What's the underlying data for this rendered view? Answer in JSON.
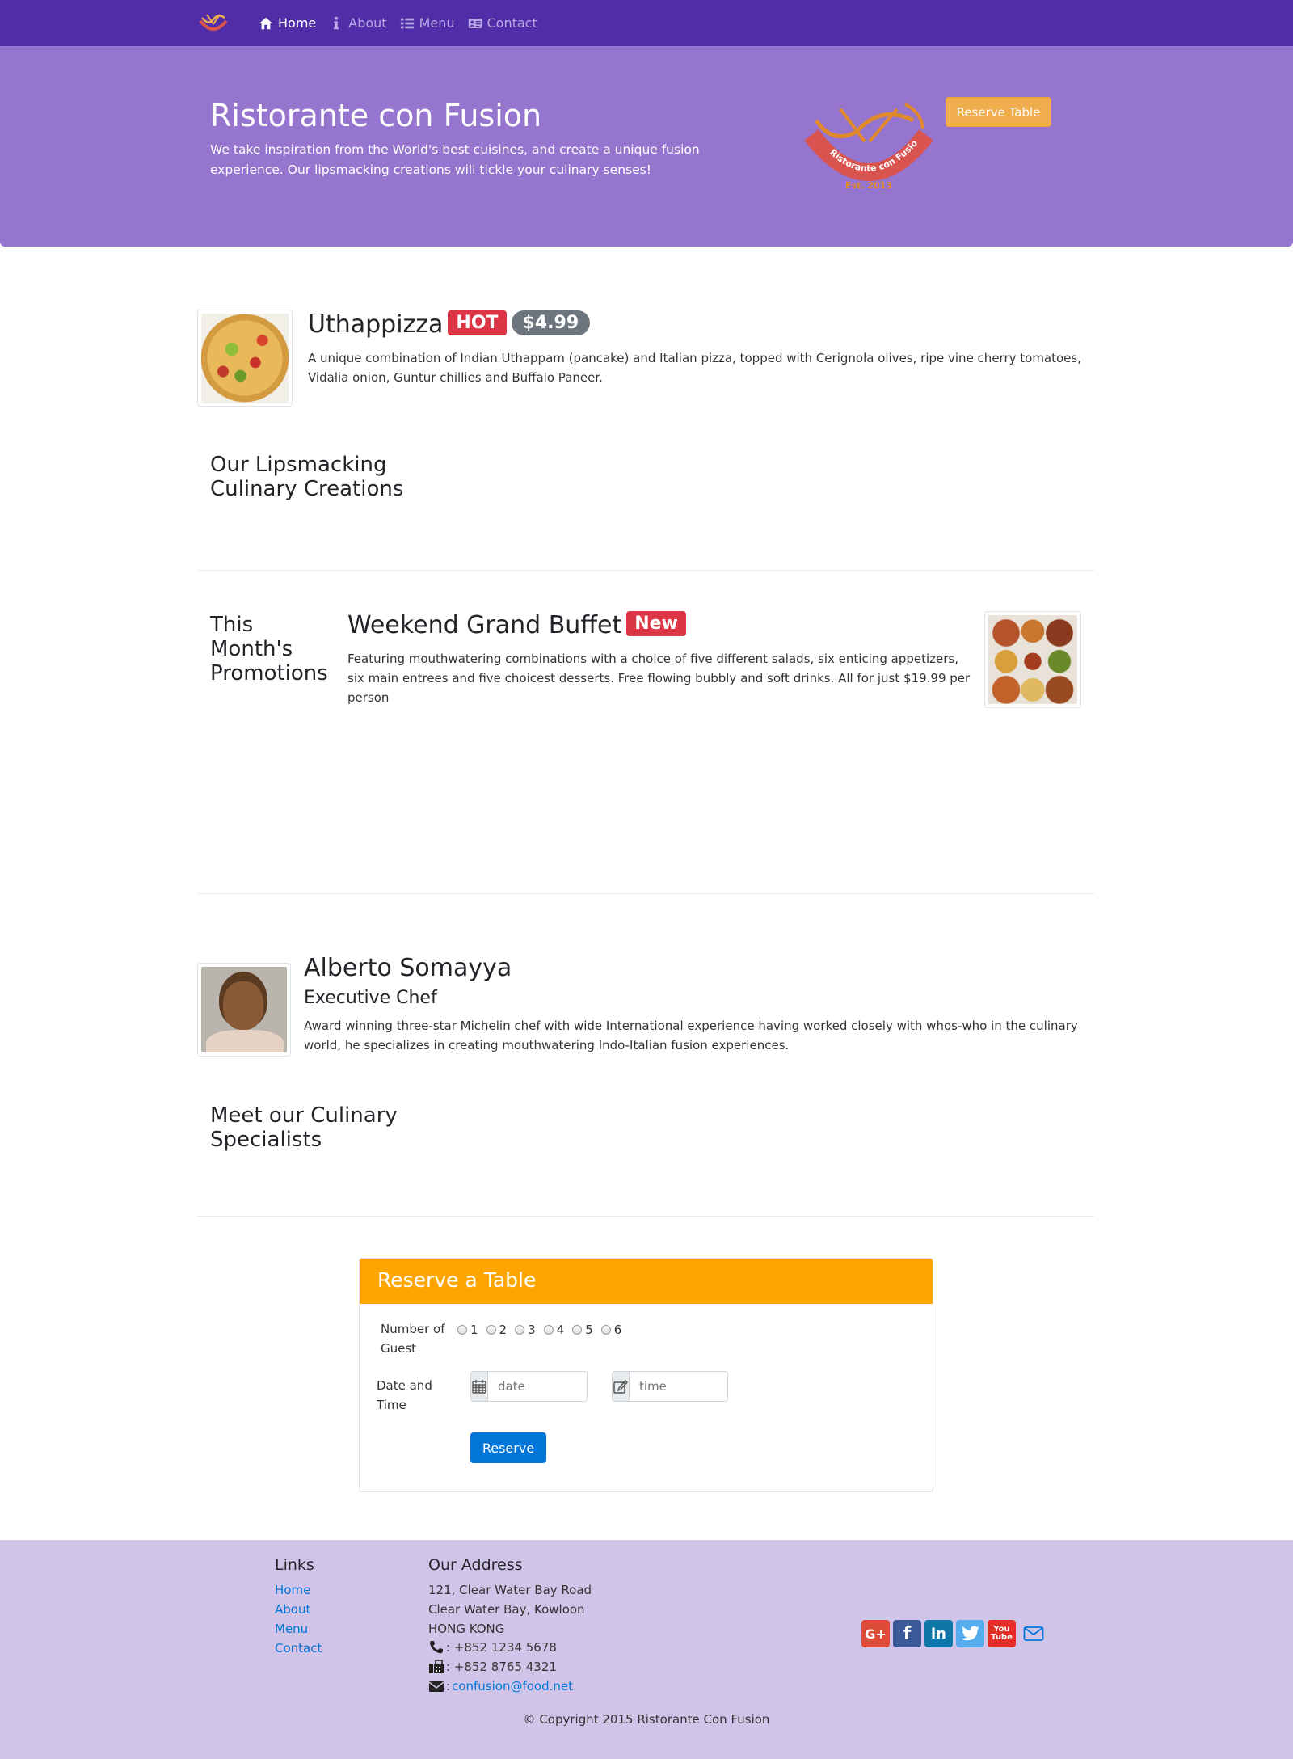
{
  "colors": {
    "navbar": "#512DA8",
    "jumbotron": "#9575CD",
    "footer": "#D1C4E9",
    "card_header": "#FFA500",
    "warning_button": "#f0ad4e",
    "primary_button": "#0275d8",
    "badge_hot": "#dc3545",
    "badge_price": "#6c757d"
  },
  "nav": {
    "logo_icon": "logo-icon",
    "items": [
      {
        "label": "Home",
        "icon": "home-icon",
        "active": true
      },
      {
        "label": "About",
        "icon": "info-icon",
        "active": false
      },
      {
        "label": "Menu",
        "icon": "list-icon",
        "active": false
      },
      {
        "label": "Contact",
        "icon": "address-card-icon",
        "active": false
      }
    ]
  },
  "jumbotron": {
    "title": "Ristorante con Fusion",
    "text": "We take inspiration from the World's best cuisines, and create a unique fusion experience. Our lipsmacking creations will tickle your culinary senses!",
    "logo_text": "Ristorante con Fusion",
    "logo_year": "Est. 2013",
    "button": "Reserve Table"
  },
  "dish": {
    "name": "Uthappizza",
    "badge": "HOT",
    "price": "$4.99",
    "description": "A unique combination of Indian Uthappam (pancake) and Italian pizza, topped with Cerignola olives, ripe vine cherry tomatoes, Vidalia onion, Guntur chillies and Buffalo Paneer.",
    "section_heading_line1": "Our Lipsmacking",
    "section_heading_line2": "Culinary Creations"
  },
  "promotion": {
    "section_heading_line1": "This",
    "section_heading_line2": "Month's",
    "section_heading_line3": "Promotions",
    "name": "Weekend Grand Buffet",
    "badge": "New",
    "description": "Featuring mouthwatering combinations with a choice of five different salads, six enticing appetizers, six main entrees and five choicest desserts. Free flowing bubbly and soft drinks. All for just $19.99 per person"
  },
  "leader": {
    "name": "Alberto Somayya",
    "designation": "Executive Chef",
    "description": "Award winning three-star Michelin chef with wide International experience having worked closely with whos-who in the culinary world, he specializes in creating mouthwatering Indo-Italian fusion experiences.",
    "section_heading_line1": "Meet our Culinary",
    "section_heading_line2": "Specialists"
  },
  "reserve": {
    "title": "Reserve a Table",
    "guests_label_line1": "Number of",
    "guests_label_line2": "Guest",
    "guest_options": [
      "1",
      "2",
      "3",
      "4",
      "5",
      "6"
    ],
    "datetime_label_line1": "Date and",
    "datetime_label_line2": "Time",
    "date_placeholder": "date",
    "time_placeholder": "time",
    "button": "Reserve"
  },
  "footer": {
    "links_heading": "Links",
    "links": [
      "Home",
      "About",
      "Menu",
      "Contact"
    ],
    "address_heading": "Our Address",
    "address_line1": "121, Clear Water Bay Road",
    "address_line2": "Clear Water Bay, Kowloon",
    "address_line3": "HONG KONG",
    "phone": ": +852 1234 5678",
    "fax": ": +852 8765 4321",
    "email_prefix": ":",
    "email": "confusion@food.net",
    "social": [
      "google-plus-icon",
      "facebook-icon",
      "linkedin-icon",
      "twitter-icon",
      "youtube-icon",
      "mail-icon"
    ],
    "copyright": "© Copyright 2015 Ristorante Con Fusion"
  }
}
